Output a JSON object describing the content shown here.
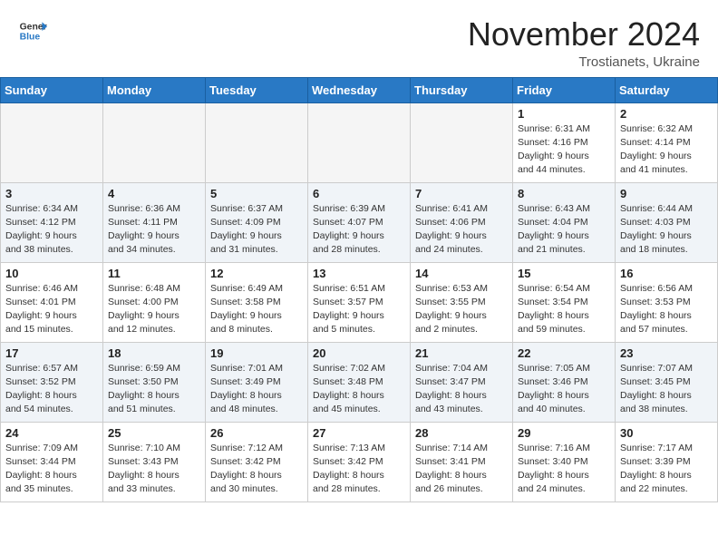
{
  "header": {
    "logo_general": "General",
    "logo_blue": "Blue",
    "month_title": "November 2024",
    "location": "Trostianets, Ukraine"
  },
  "weekdays": [
    "Sunday",
    "Monday",
    "Tuesday",
    "Wednesday",
    "Thursday",
    "Friday",
    "Saturday"
  ],
  "weeks": [
    [
      {
        "day": "",
        "info": ""
      },
      {
        "day": "",
        "info": ""
      },
      {
        "day": "",
        "info": ""
      },
      {
        "day": "",
        "info": ""
      },
      {
        "day": "",
        "info": ""
      },
      {
        "day": "1",
        "info": "Sunrise: 6:31 AM\nSunset: 4:16 PM\nDaylight: 9 hours\nand 44 minutes."
      },
      {
        "day": "2",
        "info": "Sunrise: 6:32 AM\nSunset: 4:14 PM\nDaylight: 9 hours\nand 41 minutes."
      }
    ],
    [
      {
        "day": "3",
        "info": "Sunrise: 6:34 AM\nSunset: 4:12 PM\nDaylight: 9 hours\nand 38 minutes."
      },
      {
        "day": "4",
        "info": "Sunrise: 6:36 AM\nSunset: 4:11 PM\nDaylight: 9 hours\nand 34 minutes."
      },
      {
        "day": "5",
        "info": "Sunrise: 6:37 AM\nSunset: 4:09 PM\nDaylight: 9 hours\nand 31 minutes."
      },
      {
        "day": "6",
        "info": "Sunrise: 6:39 AM\nSunset: 4:07 PM\nDaylight: 9 hours\nand 28 minutes."
      },
      {
        "day": "7",
        "info": "Sunrise: 6:41 AM\nSunset: 4:06 PM\nDaylight: 9 hours\nand 24 minutes."
      },
      {
        "day": "8",
        "info": "Sunrise: 6:43 AM\nSunset: 4:04 PM\nDaylight: 9 hours\nand 21 minutes."
      },
      {
        "day": "9",
        "info": "Sunrise: 6:44 AM\nSunset: 4:03 PM\nDaylight: 9 hours\nand 18 minutes."
      }
    ],
    [
      {
        "day": "10",
        "info": "Sunrise: 6:46 AM\nSunset: 4:01 PM\nDaylight: 9 hours\nand 15 minutes."
      },
      {
        "day": "11",
        "info": "Sunrise: 6:48 AM\nSunset: 4:00 PM\nDaylight: 9 hours\nand 12 minutes."
      },
      {
        "day": "12",
        "info": "Sunrise: 6:49 AM\nSunset: 3:58 PM\nDaylight: 9 hours\nand 8 minutes."
      },
      {
        "day": "13",
        "info": "Sunrise: 6:51 AM\nSunset: 3:57 PM\nDaylight: 9 hours\nand 5 minutes."
      },
      {
        "day": "14",
        "info": "Sunrise: 6:53 AM\nSunset: 3:55 PM\nDaylight: 9 hours\nand 2 minutes."
      },
      {
        "day": "15",
        "info": "Sunrise: 6:54 AM\nSunset: 3:54 PM\nDaylight: 8 hours\nand 59 minutes."
      },
      {
        "day": "16",
        "info": "Sunrise: 6:56 AM\nSunset: 3:53 PM\nDaylight: 8 hours\nand 57 minutes."
      }
    ],
    [
      {
        "day": "17",
        "info": "Sunrise: 6:57 AM\nSunset: 3:52 PM\nDaylight: 8 hours\nand 54 minutes."
      },
      {
        "day": "18",
        "info": "Sunrise: 6:59 AM\nSunset: 3:50 PM\nDaylight: 8 hours\nand 51 minutes."
      },
      {
        "day": "19",
        "info": "Sunrise: 7:01 AM\nSunset: 3:49 PM\nDaylight: 8 hours\nand 48 minutes."
      },
      {
        "day": "20",
        "info": "Sunrise: 7:02 AM\nSunset: 3:48 PM\nDaylight: 8 hours\nand 45 minutes."
      },
      {
        "day": "21",
        "info": "Sunrise: 7:04 AM\nSunset: 3:47 PM\nDaylight: 8 hours\nand 43 minutes."
      },
      {
        "day": "22",
        "info": "Sunrise: 7:05 AM\nSunset: 3:46 PM\nDaylight: 8 hours\nand 40 minutes."
      },
      {
        "day": "23",
        "info": "Sunrise: 7:07 AM\nSunset: 3:45 PM\nDaylight: 8 hours\nand 38 minutes."
      }
    ],
    [
      {
        "day": "24",
        "info": "Sunrise: 7:09 AM\nSunset: 3:44 PM\nDaylight: 8 hours\nand 35 minutes."
      },
      {
        "day": "25",
        "info": "Sunrise: 7:10 AM\nSunset: 3:43 PM\nDaylight: 8 hours\nand 33 minutes."
      },
      {
        "day": "26",
        "info": "Sunrise: 7:12 AM\nSunset: 3:42 PM\nDaylight: 8 hours\nand 30 minutes."
      },
      {
        "day": "27",
        "info": "Sunrise: 7:13 AM\nSunset: 3:42 PM\nDaylight: 8 hours\nand 28 minutes."
      },
      {
        "day": "28",
        "info": "Sunrise: 7:14 AM\nSunset: 3:41 PM\nDaylight: 8 hours\nand 26 minutes."
      },
      {
        "day": "29",
        "info": "Sunrise: 7:16 AM\nSunset: 3:40 PM\nDaylight: 8 hours\nand 24 minutes."
      },
      {
        "day": "30",
        "info": "Sunrise: 7:17 AM\nSunset: 3:39 PM\nDaylight: 8 hours\nand 22 minutes."
      }
    ]
  ]
}
